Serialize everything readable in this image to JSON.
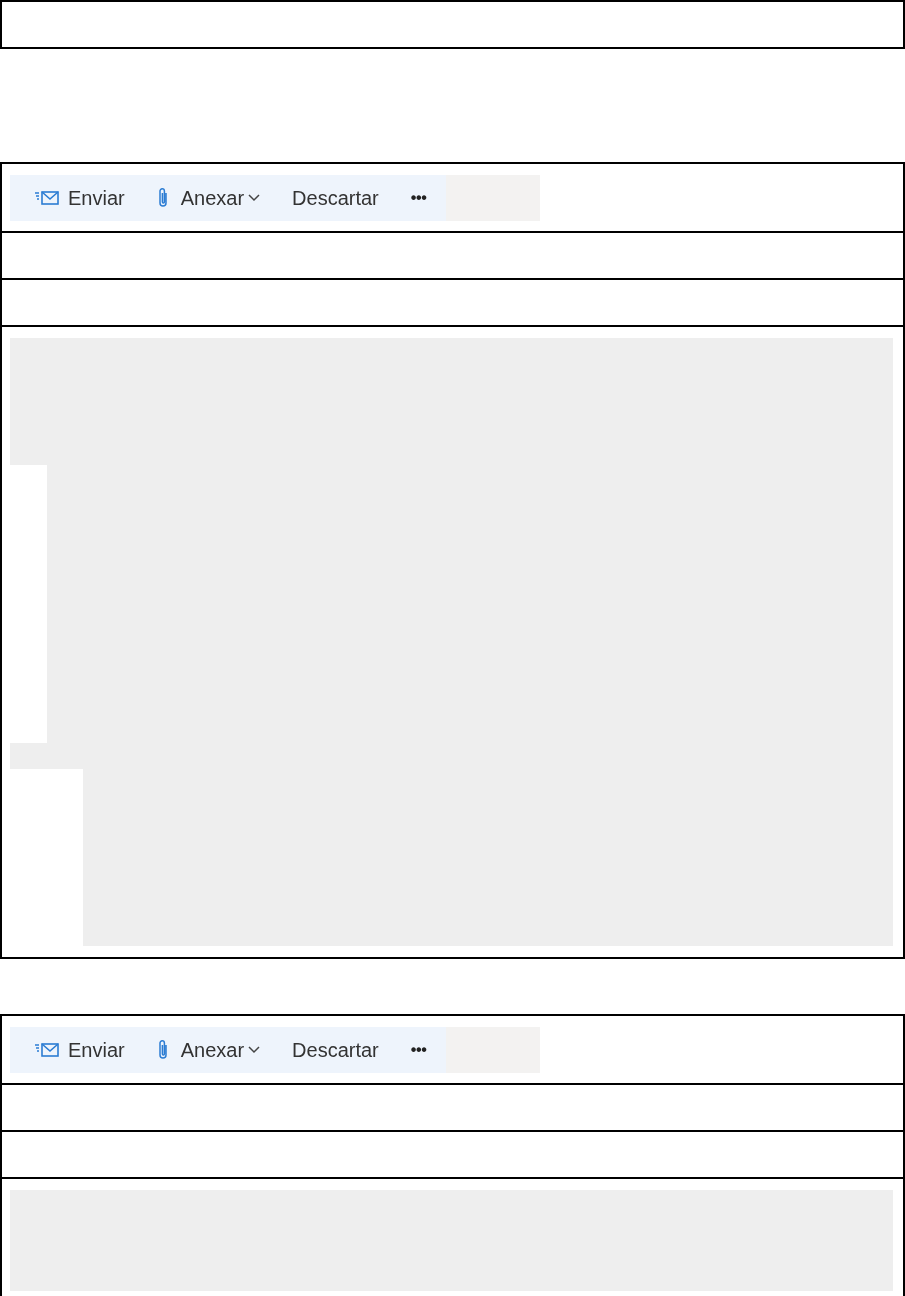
{
  "compose_panels": [
    {
      "toolbar": [
        {
          "kind": "send",
          "label": "Enviar"
        },
        {
          "kind": "attach",
          "label": "Anexar"
        },
        {
          "kind": "discard",
          "label": "Descartar"
        },
        {
          "kind": "more",
          "label": "•••"
        }
      ],
      "body": {
        "kind": "tall"
      }
    },
    {
      "toolbar": [
        {
          "kind": "send",
          "label": "Enviar"
        },
        {
          "kind": "attach",
          "label": "Anexar"
        },
        {
          "kind": "discard",
          "label": "Descartar"
        },
        {
          "kind": "more",
          "label": "•••"
        }
      ],
      "body": {
        "kind": "short"
      }
    }
  ]
}
